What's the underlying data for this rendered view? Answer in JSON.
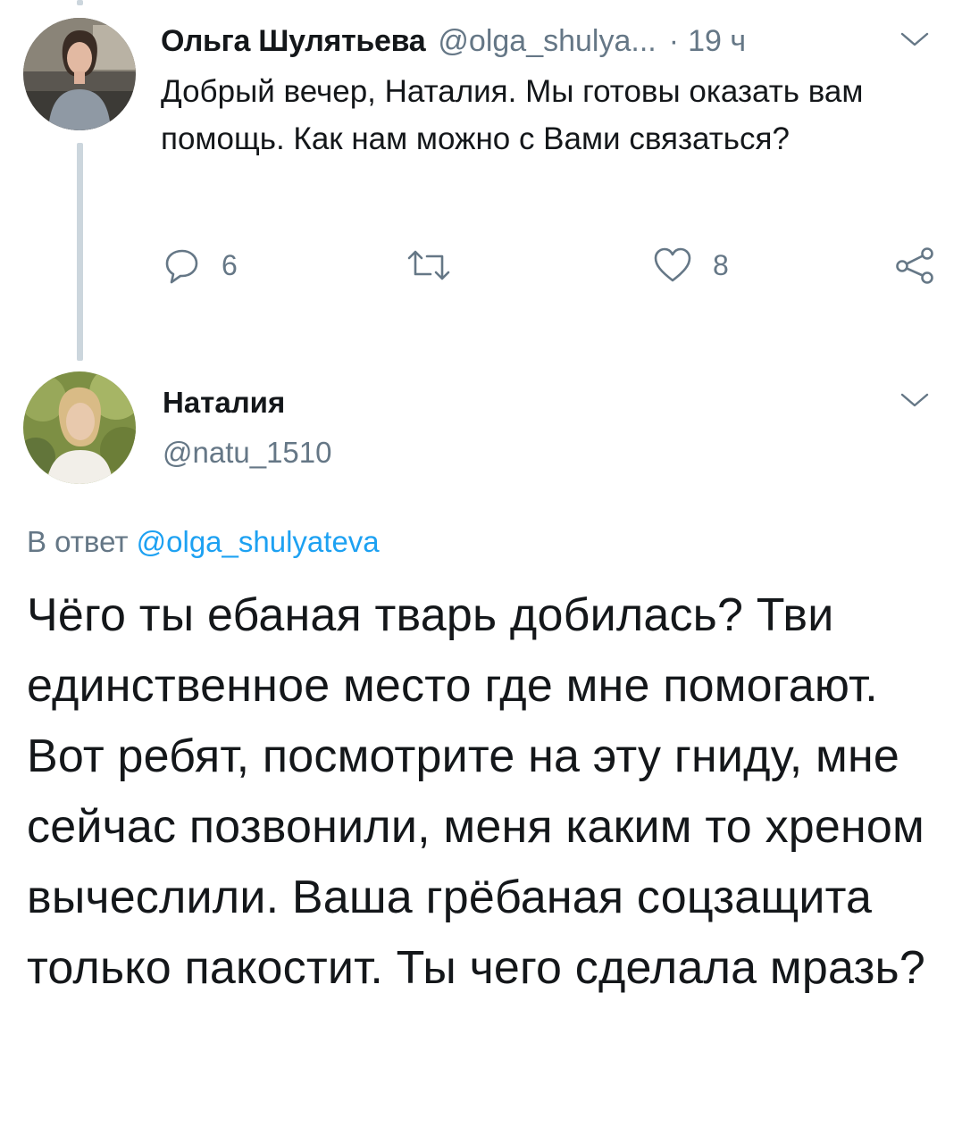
{
  "tweet1": {
    "author_name": "Ольга Шулятьева",
    "handle": "@olga_shulya...",
    "separator": "·",
    "time": "19 ч",
    "text": "Добрый вечер, Наталия. Мы готовы оказать вам помощь. Как нам можно с Вами связаться?",
    "reply_count": "6",
    "retweet_count": "",
    "like_count": "8"
  },
  "tweet2": {
    "author_name": "Наталия",
    "handle": "@natu_1510",
    "reply_prefix": "В ответ",
    "reply_mention": "@olga_shulyateva",
    "text": "Чёго ты ебаная тварь добилась? Тви единственное место где мне помогают. Вот ребят, посмотрите на эту гниду, мне сейчас позвонили, меня каким то хреном вычеслили. Ваша грёбаная соцзащита только пакостит. Ты чего сделала мразь?"
  },
  "colors": {
    "text_primary": "#14171a",
    "text_secondary": "#657786",
    "link": "#1da1f2",
    "thread_line": "#ccd6dd"
  },
  "icons": {
    "reply": "reply-icon",
    "retweet": "retweet-icon",
    "like": "heart-icon",
    "share": "share-icon",
    "menu": "chevron-down-icon"
  }
}
